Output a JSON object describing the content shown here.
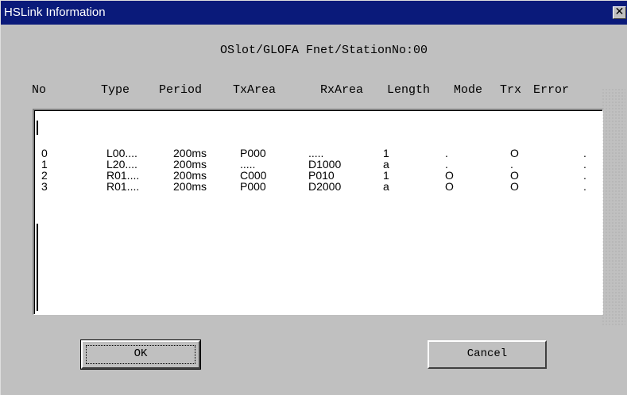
{
  "window": {
    "title": "HSLink Information",
    "close_glyph": "✕"
  },
  "subtitle": "OSlot/GLOFA Fnet/StationNo:00",
  "columns": [
    "No",
    "Type",
    "Period",
    "TxArea",
    "RxArea",
    "Length",
    "Mode",
    "Trx",
    "Error"
  ],
  "rows": [
    {
      "no": "0",
      "type": "L00....",
      "period": "200ms",
      "tx": "P000",
      "rx": ".....",
      "length": "1",
      "mode": ".",
      "trx": "O",
      "error": "."
    },
    {
      "no": "1",
      "type": "L20....",
      "period": "200ms",
      "tx": ".....",
      "rx": "D1000",
      "length": "a",
      "mode": ".",
      "trx": ".",
      "error": "."
    },
    {
      "no": "2",
      "type": "R01....",
      "period": "200ms",
      "tx": "C000",
      "rx": "P010",
      "length": "1",
      "mode": "O",
      "trx": "O",
      "error": "."
    },
    {
      "no": "3",
      "type": "R01....",
      "period": "200ms",
      "tx": "P000",
      "rx": "D2000",
      "length": "a",
      "mode": "O",
      "trx": "O",
      "error": "."
    }
  ],
  "buttons": {
    "ok": "OK",
    "cancel": "Cancel"
  },
  "colors": {
    "title_bar": "#0a1a7a",
    "dialog_bg": "#c0c0c0",
    "list_bg": "#ffffff"
  },
  "icons": {
    "close": "close-icon"
  }
}
